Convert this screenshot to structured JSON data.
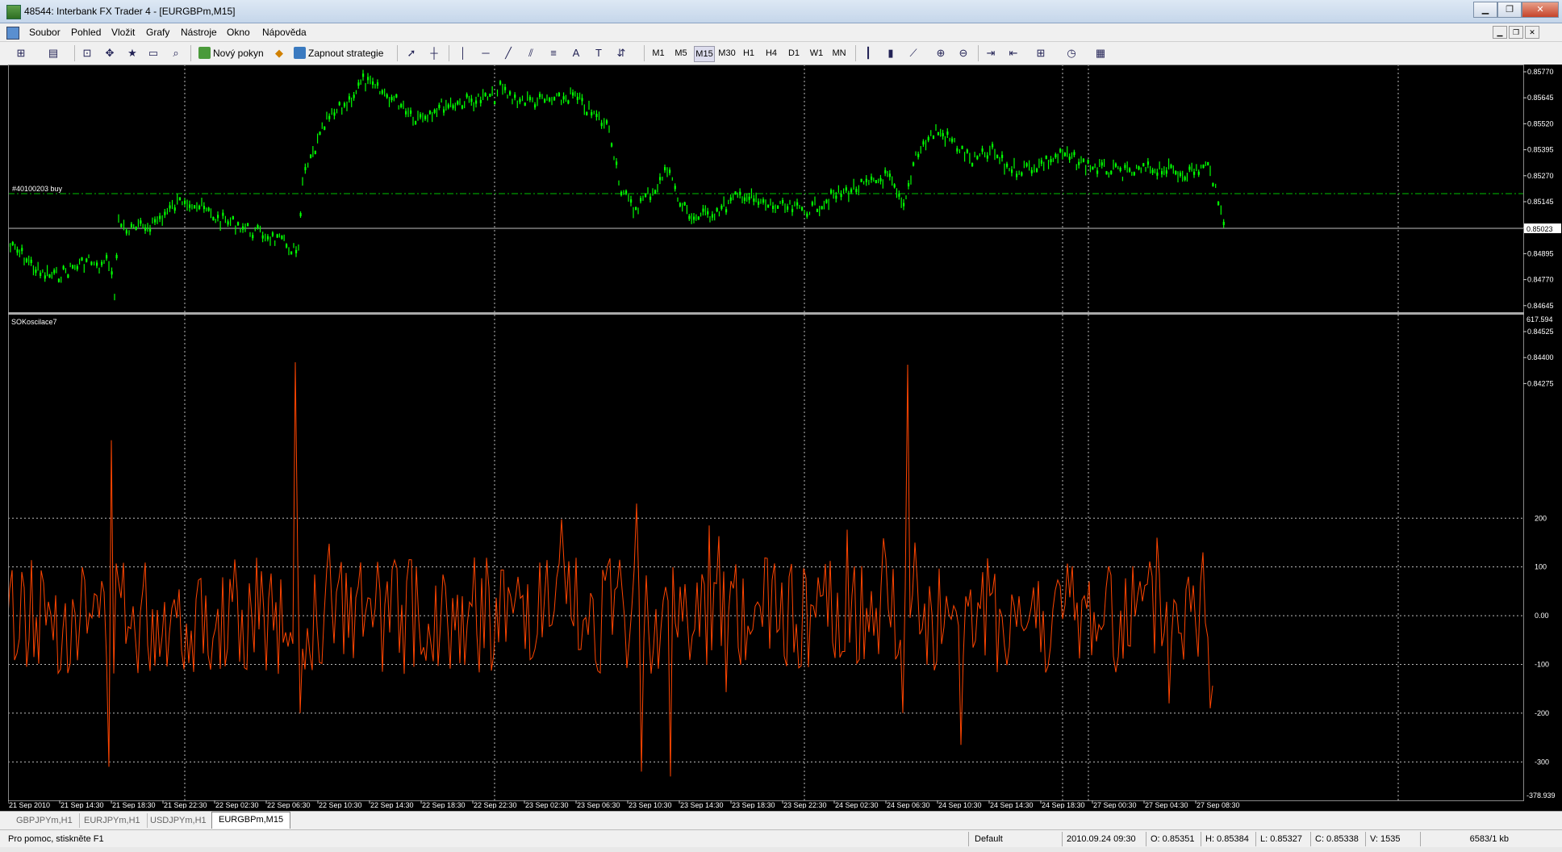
{
  "window": {
    "title": "48544: Interbank FX Trader 4 - [EURGBPm,M15]"
  },
  "menu": [
    "Soubor",
    "Pohled",
    "Vložit",
    "Grafy",
    "Nástroje",
    "Okno",
    "Nápověda"
  ],
  "toolbar": {
    "new_order": "Nový pokyn",
    "strategies": "Zapnout strategie",
    "timeframes": [
      "M1",
      "M5",
      "M15",
      "M30",
      "H1",
      "H4",
      "D1",
      "W1",
      "MN"
    ]
  },
  "main_chart": {
    "order_label": "#40100203 buy",
    "price_axis": [
      "0.85770",
      "0.85645",
      "0.85520",
      "0.85395",
      "0.85270",
      "0.85145",
      "0.85020",
      "0.84895",
      "0.84770",
      "0.84645",
      "0.84525",
      "0.84400",
      "0.84275"
    ],
    "current_price": "0.85023",
    "line_color": "#00ff00"
  },
  "indicator": {
    "name": "SOKoscilace7",
    "max_label": "617.594",
    "min_label": "-378.939",
    "levels": [
      "200",
      "100",
      "0.00",
      "-100",
      "-200",
      "-300"
    ],
    "line_color": "#ff4500"
  },
  "time_axis": [
    "21 Sep 2010",
    "21 Sep 14:30",
    "21 Sep 18:30",
    "21 Sep 22:30",
    "22 Sep 02:30",
    "22 Sep 06:30",
    "22 Sep 10:30",
    "22 Sep 14:30",
    "22 Sep 18:30",
    "22 Sep 22:30",
    "23 Sep 02:30",
    "23 Sep 06:30",
    "23 Sep 10:30",
    "23 Sep 14:30",
    "23 Sep 18:30",
    "23 Sep 22:30",
    "24 Sep 02:30",
    "24 Sep 06:30",
    "24 Sep 10:30",
    "24 Sep 14:30",
    "24 Sep 18:30",
    "27 Sep 00:30",
    "27 Sep 04:30",
    "27 Sep 08:30"
  ],
  "tabs": [
    "GBPJPYm,H1",
    "EURJPYm,H1",
    "USDJPYm,H1",
    "EURGBPm,M15"
  ],
  "active_tab": "EURGBPm,M15",
  "status": {
    "help": "Pro pomoc, stiskněte F1",
    "profile": "Default",
    "datetime": "2010.09.24 09:30",
    "open": "O: 0.85351",
    "high": "H: 0.85384",
    "low": "L: 0.85327",
    "close": "C: 0.85338",
    "volume": "V: 1535",
    "traffic": "6583/1 kb"
  }
}
